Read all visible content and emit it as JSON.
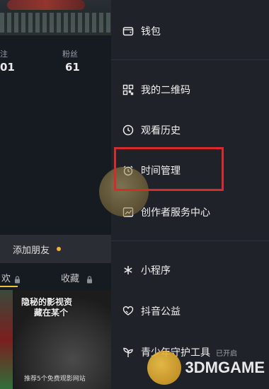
{
  "profile": {
    "following_label": "注",
    "following_value": "01",
    "followers_label": "粉丝",
    "followers_value": "61",
    "add_friend_label": "添加朋友",
    "tabs": [
      "欢",
      "收藏"
    ],
    "thumb_title_line1": "隐秘的影视资",
    "thumb_title_line2": "藏在某个",
    "thumb_caption": "推荐5个免费观影网站"
  },
  "menu": {
    "items": [
      {
        "label": "钱包",
        "icon": "wallet-icon"
      },
      {
        "label": "我的二维码",
        "icon": "qr-code-icon"
      },
      {
        "label": "观看历史",
        "icon": "clock-icon"
      },
      {
        "label": "时间管理",
        "icon": "alarm-clock-icon"
      },
      {
        "label": "创作者服务中心",
        "icon": "chart-icon"
      },
      {
        "label": "小程序",
        "icon": "asterisk-icon"
      },
      {
        "label": "抖音公益",
        "icon": "heart-hands-icon"
      },
      {
        "label": "青少年守护工具",
        "icon": "sprout-icon",
        "status": "已开启"
      }
    ]
  },
  "watermark": {
    "text": "3DMGAME"
  },
  "colors": {
    "highlight": "#d62b2b",
    "accent": "#f2c232"
  }
}
